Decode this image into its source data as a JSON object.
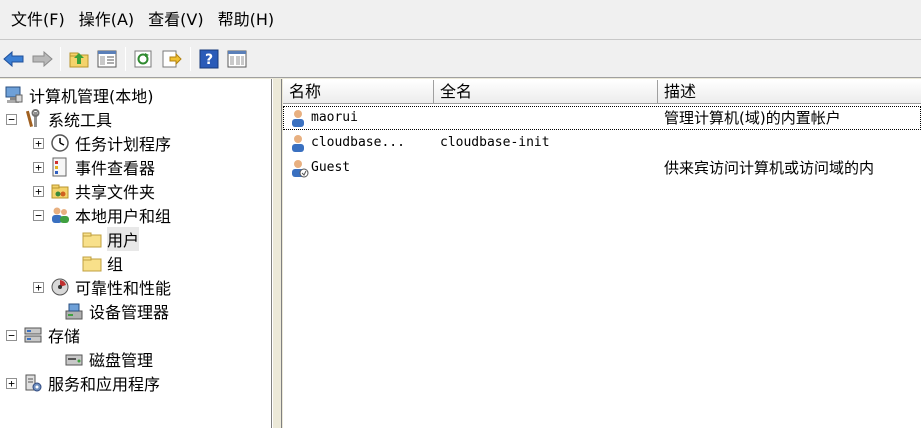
{
  "menubar": {
    "items": [
      "文件(F)",
      "操作(A)",
      "查看(V)",
      "帮助(H)"
    ]
  },
  "toolbar": {
    "buttons": [
      "back-icon",
      "forward-icon",
      "up-folder-icon",
      "show-hide-tree-icon",
      "refresh-icon",
      "export-list-icon",
      "help-icon",
      "properties-icon"
    ]
  },
  "tree": {
    "root": "计算机管理(本地)",
    "system_tools": "系统工具",
    "task_scheduler": "任务计划程序",
    "event_viewer": "事件查看器",
    "shared_folders": "共享文件夹",
    "local_users_groups": "本地用户和组",
    "users": "用户",
    "groups": "组",
    "reliability": "可靠性和性能",
    "device_manager": "设备管理器",
    "storage": "存储",
    "disk_management": "磁盘管理",
    "services_apps": "服务和应用程序"
  },
  "list": {
    "columns": [
      "名称",
      "全名",
      "描述"
    ],
    "rows": [
      {
        "name": "maorui",
        "full_name": "",
        "description": "管理计算机(域)的内置帐户"
      },
      {
        "name": "cloudbase...",
        "full_name": "cloudbase-init",
        "description": ""
      },
      {
        "name": "Guest",
        "full_name": "",
        "description": "供来宾访问计算机或访问域的内"
      }
    ]
  },
  "colors": {
    "window_bg": "#ece9d8",
    "toolbar_bg": "#f0f0f0",
    "selection_bg": "#e8e8e8"
  }
}
